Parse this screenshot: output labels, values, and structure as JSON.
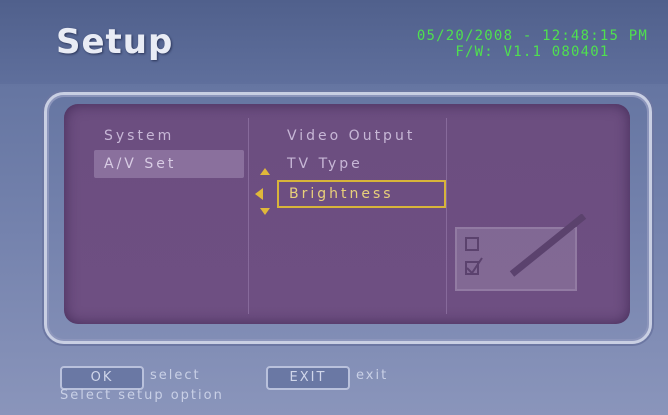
{
  "header": {
    "title": "Setup",
    "date_time": "05/20/2008 - 12:48:15 PM",
    "firmware": "F/W: V1.1 080401"
  },
  "menu": {
    "categories": [
      {
        "label": "System",
        "selected": false
      },
      {
        "label": "A/V Set",
        "selected": true
      }
    ],
    "options": [
      {
        "label": "Video Output",
        "focused": false
      },
      {
        "label": "TV Type",
        "focused": false
      },
      {
        "label": "Brightness",
        "focused": true
      }
    ]
  },
  "footer": {
    "ok_key": "OK",
    "ok_action": "select",
    "exit_key": "EXIT",
    "exit_action": "exit",
    "status": "Select setup option"
  },
  "colors": {
    "accent_highlight": "#d8b43a",
    "datetime_green": "#4fe04f",
    "panel_purple": "#6c4e80"
  },
  "icons": [
    "up-arrow-icon",
    "left-arrow-icon",
    "down-arrow-icon",
    "checklist-pencil-icon"
  ]
}
